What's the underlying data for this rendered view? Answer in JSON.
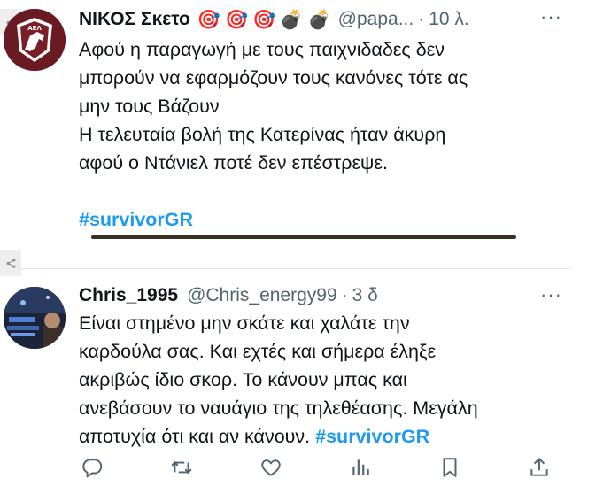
{
  "tweets": [
    {
      "display_name": "ΝΙΚΟΣ Σκετο",
      "badges": [
        "🎯",
        "🎯",
        "🎯",
        "💣",
        "💣"
      ],
      "handle": "@papa...",
      "separator": "·",
      "time": "10 λ.",
      "more": "···",
      "text_lines": [
        "Αφού η παραγωγή με τους παιχνιδαδες  δεν",
        "μπορούν να εφαρμόζουν τους κανόνες  τότε ας",
        "μην τους Βάζουν",
        "Η τελευταία βολή της Κατερίνας ήταν άκυρη",
        "αφού ο Ντάνιελ ποτέ δεν επέστρεψε."
      ],
      "hashtag": "#survivorGR"
    },
    {
      "display_name": "Chris_1995",
      "handle": "@Chris_energy99",
      "separator": "·",
      "time": "3 δ",
      "more": "···",
      "text_lines": [
        "Είναι στημένο μην σκάτε και χαλάτε την",
        "καρδούλα σας. Και εχτές και σήμερα έληξε",
        "ακριβώς ίδιο σκορ. Το κάνουν μπας και",
        "ανεβάσουν το ναυάγιο της τηλεθέασης. Μεγάλη"
      ],
      "last_line_text": "αποτυχία ότι και αν κάνουν.",
      "hashtag": "#survivorGR"
    }
  ],
  "icons": {
    "share_tab": "share-icon",
    "reply": "reply-icon",
    "retweet": "retweet-icon",
    "like": "heart-icon",
    "views": "views-chart-icon",
    "bookmark": "bookmark-icon",
    "share": "share-upload-icon"
  },
  "colors": {
    "hashtag": "#1d9bf0",
    "secondary_text": "#536471",
    "primary_text": "#0f1419",
    "avatar1_bg": "#6a1a23"
  }
}
